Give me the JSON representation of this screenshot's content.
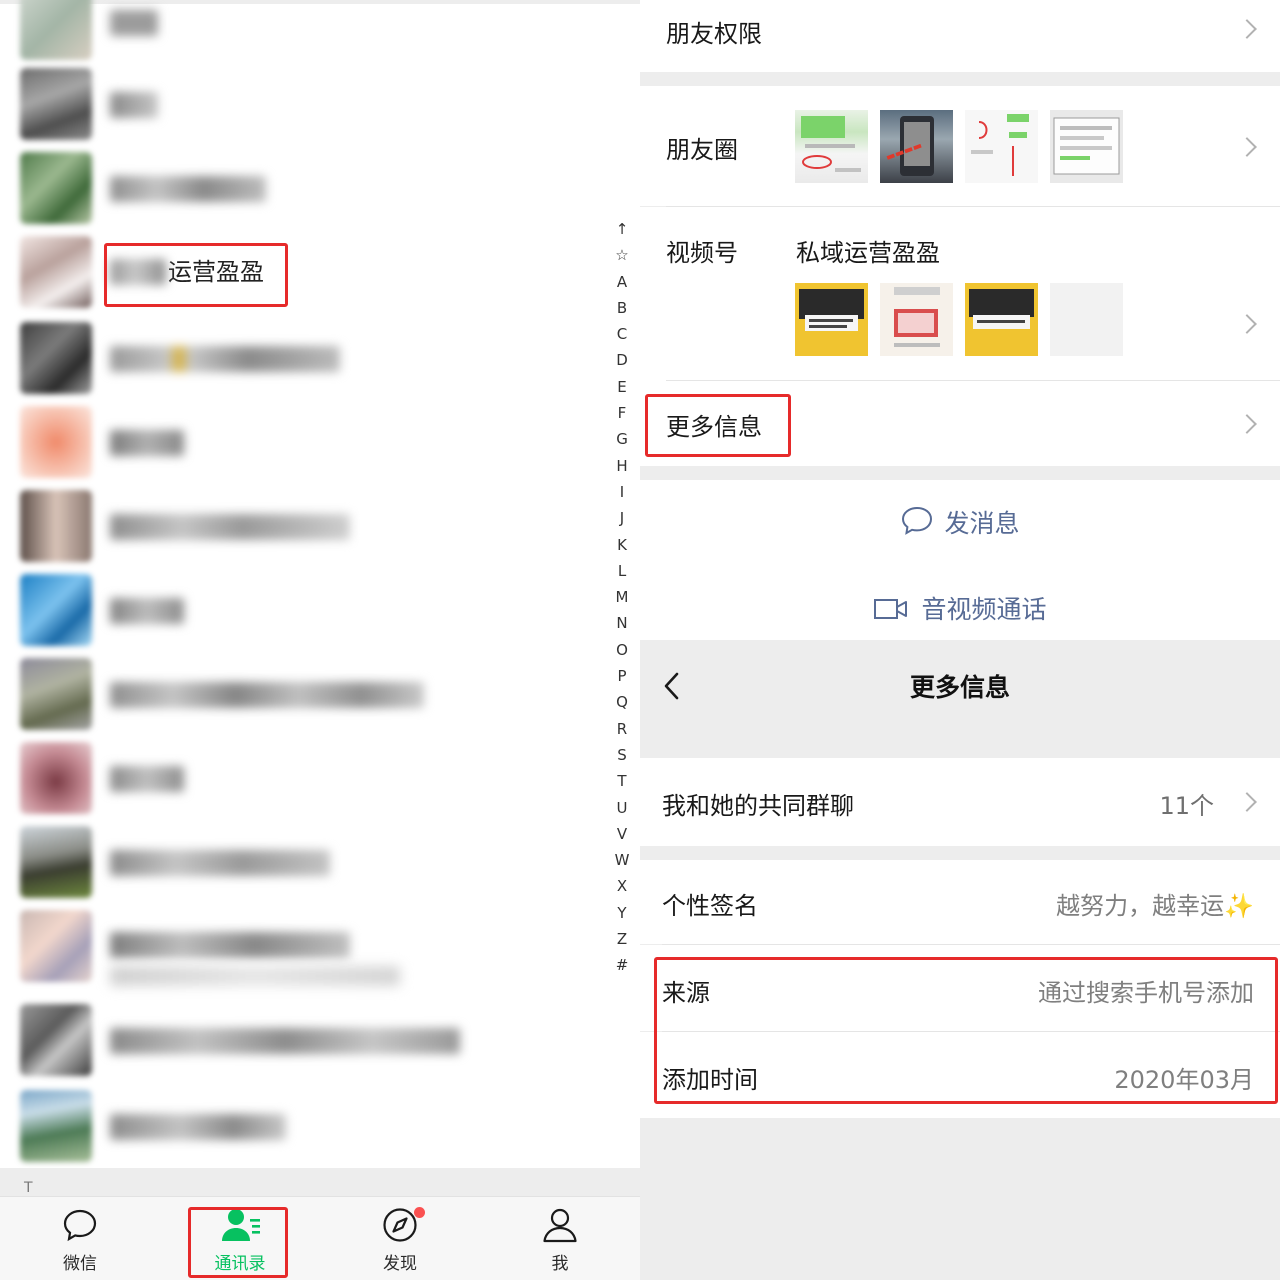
{
  "contacts": {
    "highlighted": {
      "name_visible_part": "运营盈盈"
    },
    "index_letters": [
      "↑",
      "☆",
      "A",
      "B",
      "C",
      "D",
      "E",
      "F",
      "G",
      "H",
      "I",
      "J",
      "K",
      "L",
      "M",
      "N",
      "O",
      "P",
      "Q",
      "R",
      "S",
      "T",
      "U",
      "V",
      "W",
      "X",
      "Y",
      "Z",
      "#"
    ],
    "section_letter": "T"
  },
  "tabbar": {
    "tabs": [
      {
        "label": "微信",
        "icon": "chat-bubble-icon"
      },
      {
        "label": "通讯录",
        "icon": "contacts-icon",
        "active": true
      },
      {
        "label": "发现",
        "icon": "compass-icon",
        "badge": "dot"
      },
      {
        "label": "我",
        "icon": "person-icon"
      }
    ],
    "active_color": "#07c160"
  },
  "profile": {
    "friend_permissions": "朋友权限",
    "moments": "朋友圈",
    "channels_label": "视频号",
    "channels_name": "私域运营盈盈",
    "more_info": "更多信息",
    "send_message": "发消息",
    "av_call": "音视频通话"
  },
  "more_info_page": {
    "title": "更多信息",
    "common_groups_label": "我和她的共同群聊",
    "common_groups_value": "11个",
    "signature_label": "个性签名",
    "signature_value": "越努力，越幸运✨",
    "source_label": "来源",
    "source_value": "通过搜索手机号添加",
    "added_time_label": "添加时间",
    "added_time_value": "2020年03月"
  },
  "colors": {
    "highlight_box": "#e62a2a",
    "link_blue": "#576b95",
    "badge_red": "#fa5151"
  }
}
